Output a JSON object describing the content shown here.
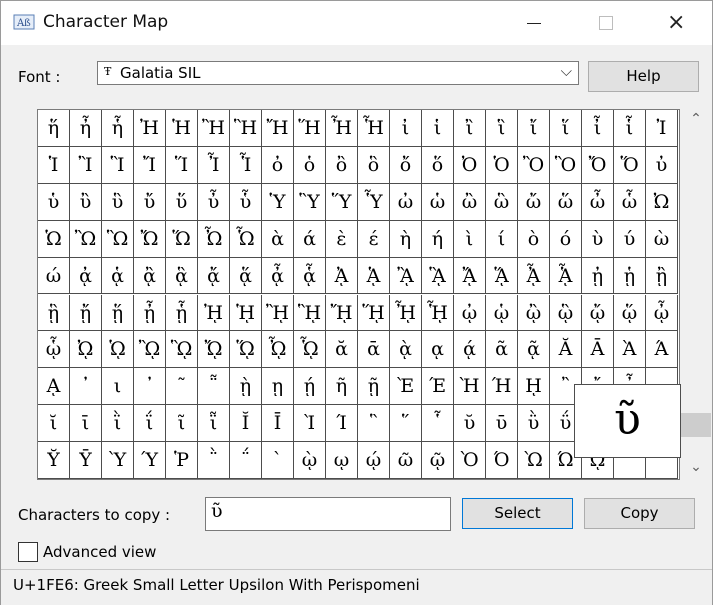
{
  "window": {
    "title": "Character Map",
    "icon": "character-map-icon",
    "controls": {
      "minimize": "minimize-icon",
      "maximize": "maximize-icon",
      "close": "×"
    }
  },
  "font": {
    "label": "Font :",
    "type_glyph": "Ŧ",
    "selected": "Galatia SIL",
    "dropdown_glyph": "⌵"
  },
  "help_label": "Help",
  "grid": {
    "columns": 20,
    "rows": 10,
    "characters": [
      "ἥ",
      "ἦ",
      "ἧ",
      "Ἠ",
      "Ἡ",
      "Ἢ",
      "Ἣ",
      "Ἤ",
      "Ἥ",
      "Ἦ",
      "Ἧ",
      "ἰ",
      "ἱ",
      "ἲ",
      "ἳ",
      "ἴ",
      "ἵ",
      "ἶ",
      "ἷ",
      "Ἰ",
      "Ἱ",
      "Ἲ",
      "Ἳ",
      "Ἴ",
      "Ἵ",
      "Ἶ",
      "Ἷ",
      "ὀ",
      "ὁ",
      "ὂ",
      "ὃ",
      "ὄ",
      "ὅ",
      "Ὀ",
      "Ὁ",
      "Ὂ",
      "Ὃ",
      "Ὄ",
      "Ὅ",
      "ὐ",
      "ὑ",
      "ὒ",
      "ὓ",
      "ὔ",
      "ὕ",
      "ὖ",
      "ὗ",
      "Ὑ",
      "Ὓ",
      "Ὕ",
      "Ὗ",
      "ὠ",
      "ὡ",
      "ὢ",
      "ὣ",
      "ὤ",
      "ὥ",
      "ὦ",
      "ὧ",
      "Ὠ",
      "Ὡ",
      "Ὢ",
      "Ὣ",
      "Ὤ",
      "Ὥ",
      "Ὦ",
      "Ὧ",
      "ὰ",
      "ά",
      "ὲ",
      "έ",
      "ὴ",
      "ή",
      "ὶ",
      "ί",
      "ὸ",
      "ό",
      "ὺ",
      "ύ",
      "ὼ",
      "ώ",
      "ᾀ",
      "ᾁ",
      "ᾂ",
      "ᾃ",
      "ᾄ",
      "ᾅ",
      "ᾆ",
      "ᾇ",
      "ᾈ",
      "ᾉ",
      "ᾊ",
      "ᾋ",
      "ᾌ",
      "ᾍ",
      "ᾎ",
      "ᾏ",
      "ᾐ",
      "ᾑ",
      "ᾒ",
      "ᾓ",
      "ᾔ",
      "ᾕ",
      "ᾖ",
      "ᾗ",
      "ᾘ",
      "ᾙ",
      "ᾚ",
      "ᾛ",
      "ᾜ",
      "ᾝ",
      "ᾞ",
      "ᾟ",
      "ᾠ",
      "ᾡ",
      "ᾢ",
      "ᾣ",
      "ᾤ",
      "ᾥ",
      "ᾦ",
      "ᾧ",
      "ᾨ",
      "ᾩ",
      "ᾪ",
      "ᾫ",
      "ᾬ",
      "ᾭ",
      "ᾮ",
      "ᾯ",
      "ᾰ",
      "ᾱ",
      "ᾲ",
      "ᾳ",
      "ᾴ",
      "ᾶ",
      "ᾷ",
      "Ᾰ",
      "Ᾱ",
      "Ὰ",
      "Ά",
      "ᾼ",
      "᾽",
      "ι",
      "᾿",
      "῀",
      "῁",
      "ῂ",
      "ῃ",
      "ῄ",
      "ῆ",
      "ῇ",
      "Ὲ",
      "Έ",
      "Ὴ",
      "Ή",
      "ῌ",
      "῍",
      "῎",
      "῏",
      "",
      "ῐ",
      "ῑ",
      "ῒ",
      "ΐ",
      "ῖ",
      "ῗ",
      "Ῐ",
      "Ῑ",
      "Ὶ",
      "Ί",
      "῝",
      "῞",
      "῟",
      "ῠ",
      "ῡ",
      "ῢ",
      "ΰ",
      "ῤ",
      "ῥ",
      "ῦ",
      "Ῠ",
      "Ῡ",
      "Ὺ",
      "Ύ",
      "Ῥ",
      "῭",
      "΅",
      "`",
      "ῲ",
      "ῳ",
      "ῴ",
      "ῶ",
      "ῷ",
      "Ὸ",
      "Ό",
      "Ὼ",
      "Ώ",
      "ῼ",
      "",
      ""
    ],
    "selected_index": 179
  },
  "zoom_char": "ῦ",
  "scrollbar": {
    "up": "⌃",
    "down": "⌄"
  },
  "copy": {
    "label": "Characters to copy :",
    "value": "ῦ"
  },
  "select_label": "Select",
  "copy_button_label": "Copy",
  "advanced": {
    "label": "Advanced view",
    "checked": false
  },
  "status": "U+1FE6: Greek Small Letter Upsilon With Perispomeni"
}
